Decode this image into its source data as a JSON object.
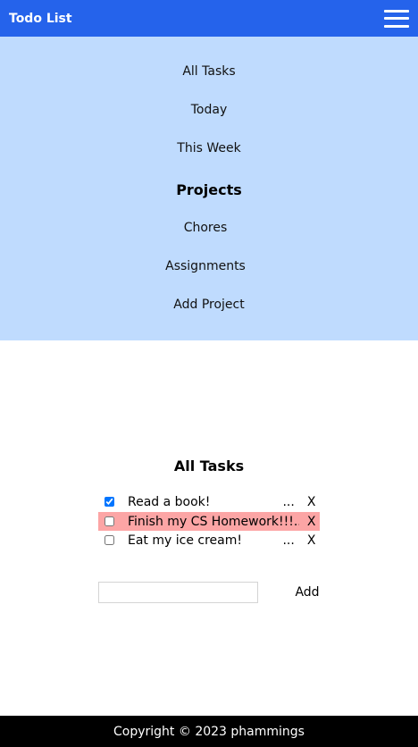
{
  "header": {
    "title": "Todo List",
    "menu_icon": "hamburger-menu-icon"
  },
  "nav": {
    "items": [
      "All Tasks",
      "Today",
      "This Week"
    ],
    "projects_heading": "Projects",
    "projects": [
      "Chores",
      "Assignments"
    ],
    "add_project": "Add Project"
  },
  "main": {
    "title": "All Tasks",
    "tasks": [
      {
        "label": "Read a book!",
        "checked": true,
        "more": "...",
        "delete": "X"
      },
      {
        "label": "Finish my CS Homework!!!...",
        "checked": false,
        "more": "",
        "delete": "X",
        "highlight_color": "#fca5a5"
      },
      {
        "label": "Eat my ice cream!",
        "checked": false,
        "more": "...",
        "delete": "X"
      }
    ],
    "add_input": {
      "value": "",
      "placeholder": ""
    },
    "add_button": "Add"
  },
  "footer": {
    "text": "Copyright © 2023 phammings"
  },
  "colors": {
    "topbar": "#2563eb",
    "nav_panel": "#bfdbfe",
    "highlight": "#fca5a5",
    "footer": "#000000"
  }
}
